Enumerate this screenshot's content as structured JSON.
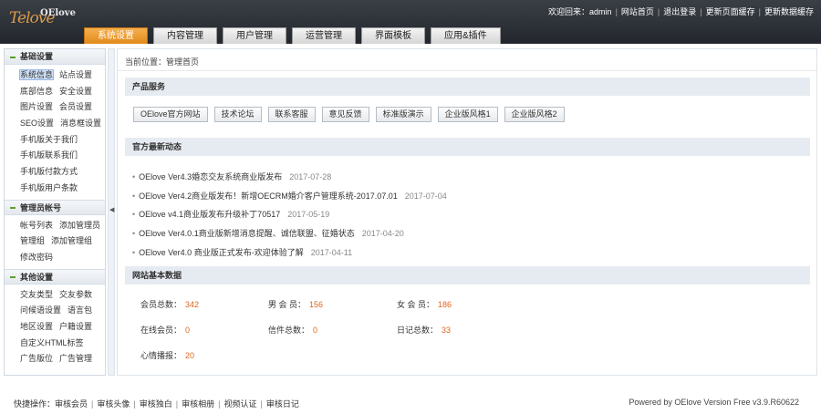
{
  "header": {
    "logo_main": "OElove",
    "logo_script": "Telove",
    "links": [
      "欢迎回来：admin",
      "网站首页",
      "退出登录",
      "更新页面缓存",
      "更新数据缓存"
    ]
  },
  "nav": {
    "tabs": [
      {
        "label": "系统设置",
        "active": true
      },
      {
        "label": "内容管理",
        "active": false
      },
      {
        "label": "用户管理",
        "active": false
      },
      {
        "label": "运营管理",
        "active": false
      },
      {
        "label": "界面模板",
        "active": false
      },
      {
        "label": "应用&插件",
        "active": false
      }
    ]
  },
  "sidebar": {
    "sections": [
      {
        "title": "基础设置",
        "rows": [
          [
            "系统信息",
            "站点设置"
          ],
          [
            "底部信息",
            "安全设置"
          ],
          [
            "图片设置",
            "会员设置"
          ],
          [
            "SEO设置",
            "消息框设置"
          ],
          [
            "手机版关于我们"
          ],
          [
            "手机版联系我们"
          ],
          [
            "手机版付款方式"
          ],
          [
            "手机版用户条款"
          ]
        ]
      },
      {
        "title": "管理员帐号",
        "rows": [
          [
            "帐号列表",
            "添加管理员"
          ],
          [
            "管理组",
            "添加管理组"
          ],
          [
            "修改密码"
          ]
        ]
      },
      {
        "title": "其他设置",
        "rows": [
          [
            "交友类型",
            "交友参数"
          ],
          [
            "问候语设置",
            "语言包"
          ],
          [
            "地区设置",
            "户籍设置"
          ],
          [
            "自定义HTML标签"
          ],
          [
            "广告版位",
            "广告管理"
          ]
        ]
      }
    ]
  },
  "main": {
    "breadcrumb": "当前位置：管理首页",
    "product_title": "产品服务",
    "product_buttons": [
      "OElove官方网站",
      "技术论坛",
      "联系客服",
      "意见反馈",
      "标准版演示",
      "企业版风格1",
      "企业版风格2"
    ],
    "news_title": "官方最新动态",
    "news": [
      {
        "text": "OElove Ver4.3婚恋交友系统商业版发布",
        "date": "2017-07-28"
      },
      {
        "text": "OElove Ver4.2商业版发布！新增OECRM婚介客户管理系统-2017.07.01",
        "date": "2017-07-04"
      },
      {
        "text": "OElove v4.1商业版发布升级补丁70517",
        "date": "2017-05-19"
      },
      {
        "text": "OElove Ver4.0.1商业版新增消息提醒、诚信联盟、征婚状态",
        "date": "2017-04-20"
      },
      {
        "text": "OElove Ver4.0 商业版正式发布-欢迎体验了解",
        "date": "2017-04-11"
      }
    ],
    "stats_title": "网站基本数据",
    "stats": {
      "members_label": "会员总数：",
      "members": "342",
      "male_label": "男 会 员：",
      "male": "156",
      "female_label": "女 会 员：",
      "female": "186",
      "online_label": "在线会员：",
      "online": "0",
      "letters_label": "信件总数：",
      "letters": "0",
      "diary_label": "日记总数：",
      "diary": "33",
      "heart_label": "心情播报：",
      "heart": "20"
    }
  },
  "footer": {
    "quick_label": "快捷操作：",
    "quick_links": [
      "审核会员",
      "审核头像",
      "审核独白",
      "审核相册",
      "视频认证",
      "审核日记"
    ],
    "powered": "Powered by OElove Version Free v3.9.R60622"
  }
}
